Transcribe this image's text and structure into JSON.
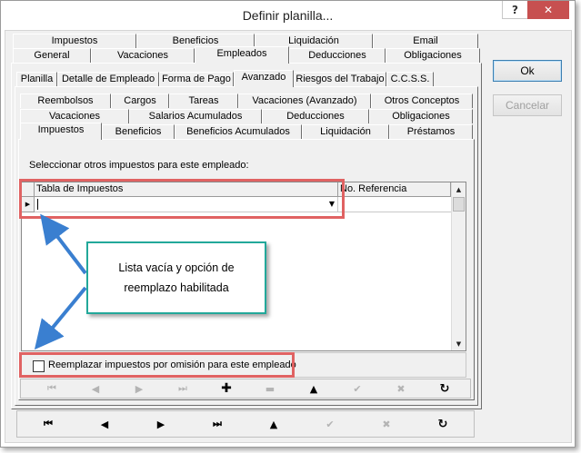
{
  "window": {
    "title": "Definir planilla..."
  },
  "title_buttons": {
    "help": "?",
    "close": "✕"
  },
  "tabs_top_row2": [
    "Impuestos",
    "Beneficios",
    "Liquidación",
    "Email"
  ],
  "tabs_top_row1": [
    "General",
    "Vacaciones",
    "Empleados",
    "Deducciones",
    "Obligaciones"
  ],
  "tabs_employee": [
    "Planilla",
    "Detalle de Empleado",
    "Forma de Pago",
    "Avanzado",
    "Riesgos del Trabajo",
    "C.C.S.S."
  ],
  "tabs_adv_row3": [
    "Reembolsos",
    "Cargos",
    "Tareas",
    "Vacaciones (Avanzado)",
    "Otros Conceptos"
  ],
  "tabs_adv_row2": [
    "Vacaciones",
    "Salarios Acumulados",
    "Deducciones",
    "Obligaciones"
  ],
  "tabs_adv_row1": [
    "Impuestos",
    "Beneficios",
    "Beneficios Acumulados",
    "Liquidación",
    "Préstamos"
  ],
  "main": {
    "instruction": "Seleccionar otros impuestos para este empleado:",
    "grid": {
      "col1": "Tabla de Impuestos",
      "col2": "No. Referencia"
    },
    "checkbox_label": "Reemplazar impuestos por omisión para este empleado"
  },
  "buttons": {
    "ok": "Ok",
    "cancel": "Cancelar"
  },
  "callout": {
    "line1": "Lista vacía y opción de",
    "line2": "reemplazo habilitada"
  },
  "colors": {
    "highlight_box": "#e06262",
    "callout_border": "#22a89a",
    "arrow": "#3a7fd0",
    "close_button": "#c75050"
  }
}
